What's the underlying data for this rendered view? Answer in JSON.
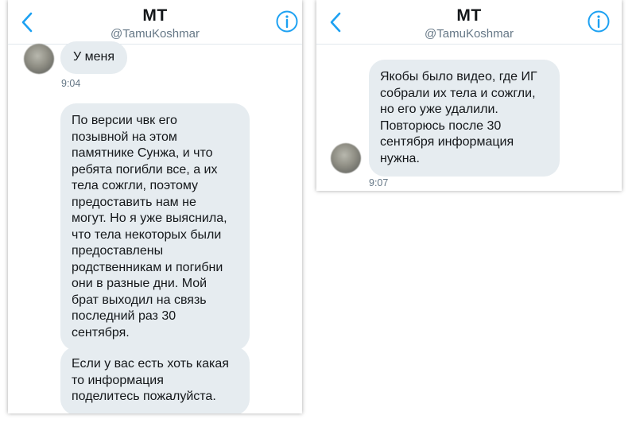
{
  "left": {
    "header": {
      "title": "MT",
      "handle": "@TamuKoshmar"
    },
    "messages": [
      {
        "text": "У меня",
        "time": "9:04"
      },
      {
        "text": "По версии чвк его\nпозывной на этом\nпамятнике Сунжа, и что\nребята погибли все, а их\nтела сожгли, поэтому\nпредоставить нам не\nмогут. Но я уже выяснила,\nчто тела некоторых были\nпредоставлены\nродственникам и погибни\nони в разные дни. Мой\nбрат выходил на связь\nпоследний раз 30\nсентября."
      },
      {
        "text": "Если у вас есть хоть какая\nто информация\nподелитесь пожалуйста."
      }
    ]
  },
  "right": {
    "header": {
      "title": "MT",
      "handle": "@TamuKoshmar"
    },
    "messages": [
      {
        "text": "Якобы было видео, где ИГ\nсобрали их тела и сожгли,\nно его уже удалили.\nПовторюсь после 30\nсентября информация\nнужна.",
        "time": "9:07"
      }
    ]
  },
  "icons": {
    "back": "chevron-left-icon",
    "info": "info-circle-icon",
    "accent": "#1da1f2",
    "bubble_bg": "#e6ecf0"
  }
}
